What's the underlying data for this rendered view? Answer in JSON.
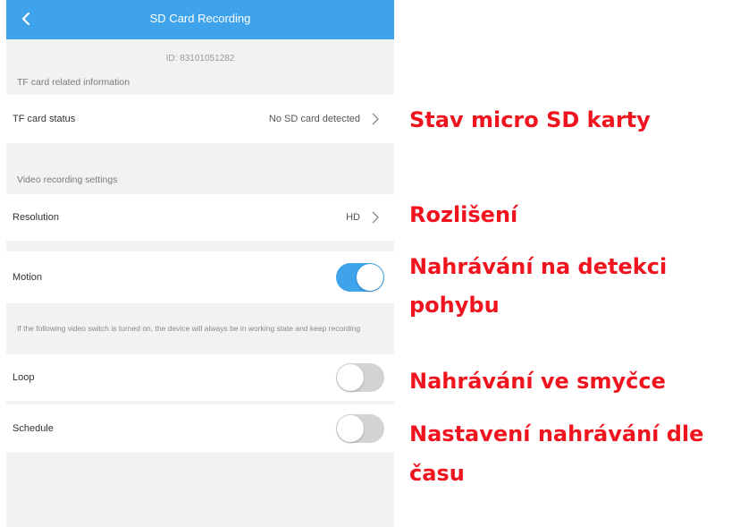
{
  "header": {
    "title": "SD Card Recording",
    "back_icon": "chevron-left-icon",
    "background_color": "#3fa3ec"
  },
  "device": {
    "id_text": "ID: 83101051282"
  },
  "sections": {
    "tf_card_info": "TF card related information",
    "video_settings": "Video recording settings"
  },
  "rows": {
    "tf_card_status": {
      "label": "TF card status",
      "value": "No SD card detected"
    },
    "resolution": {
      "label": "Resolution",
      "value": "HD"
    },
    "motion": {
      "label": "Motion",
      "on": true
    },
    "loop": {
      "label": "Loop",
      "on": false
    },
    "schedule": {
      "label": "Schedule",
      "on": false
    }
  },
  "note": "If the following video switch is turned on, the device will always be in working state and keep recording",
  "annotations": {
    "tf_status": "Stav micro SD karty",
    "resolution": "Rozlišení",
    "motion_line1": "Nahrávání na detekci",
    "motion_line2": "pohybu",
    "loop": "Nahrávání ve smyčce",
    "schedule_line1": "Nastavení nahrávání dle",
    "schedule_line2": "času",
    "color": "#f0141e"
  },
  "colors": {
    "accent": "#3fa3ec",
    "toggle_off": "#d3d3d3",
    "page_bg": "#f2f2f2"
  }
}
